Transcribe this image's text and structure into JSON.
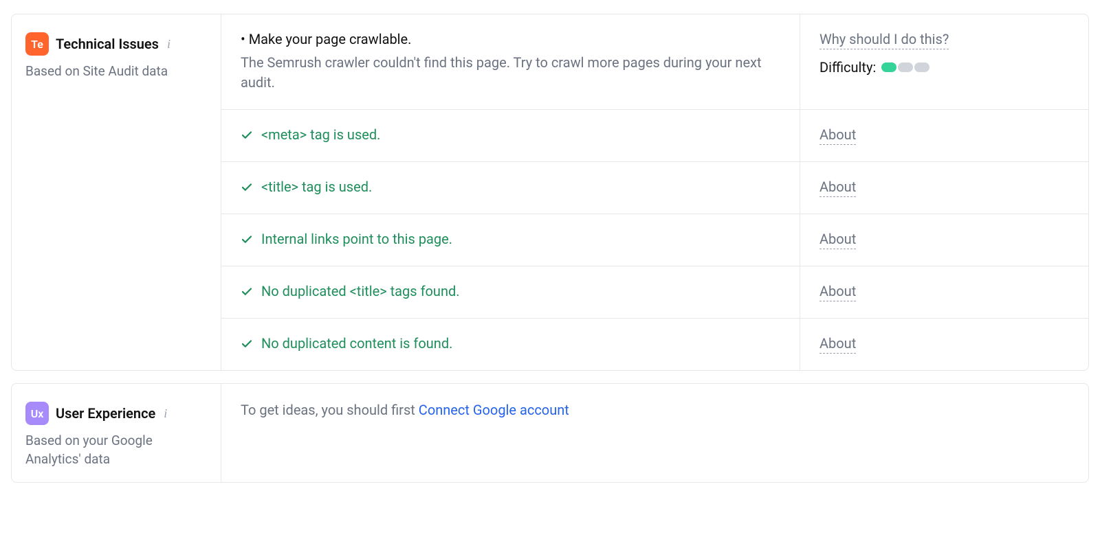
{
  "technical": {
    "badge": "Te",
    "title": "Technical Issues",
    "subtitle": "Based on Site Audit data",
    "issue": {
      "title": "• Make your page crawlable.",
      "description": "The Semrush crawler couldn't find this page. Try to crawl more pages during your next audit.",
      "why_link": "Why should I do this?",
      "difficulty_label": "Difficulty:",
      "difficulty_level": 1,
      "difficulty_total": 3
    },
    "checks": [
      {
        "text": "<meta> tag is used.",
        "about": "About"
      },
      {
        "text": "<title> tag is used.",
        "about": "About"
      },
      {
        "text": "Internal links point to this page.",
        "about": "About"
      },
      {
        "text": "No duplicated <title> tags found.",
        "about": "About"
      },
      {
        "text": "No duplicated content is found.",
        "about": "About"
      }
    ]
  },
  "ux": {
    "badge": "Ux",
    "title": "User Experience",
    "subtitle": "Based on your Google Analytics' data",
    "prompt_prefix": "To get ideas, you should first ",
    "prompt_link": "Connect Google account"
  }
}
